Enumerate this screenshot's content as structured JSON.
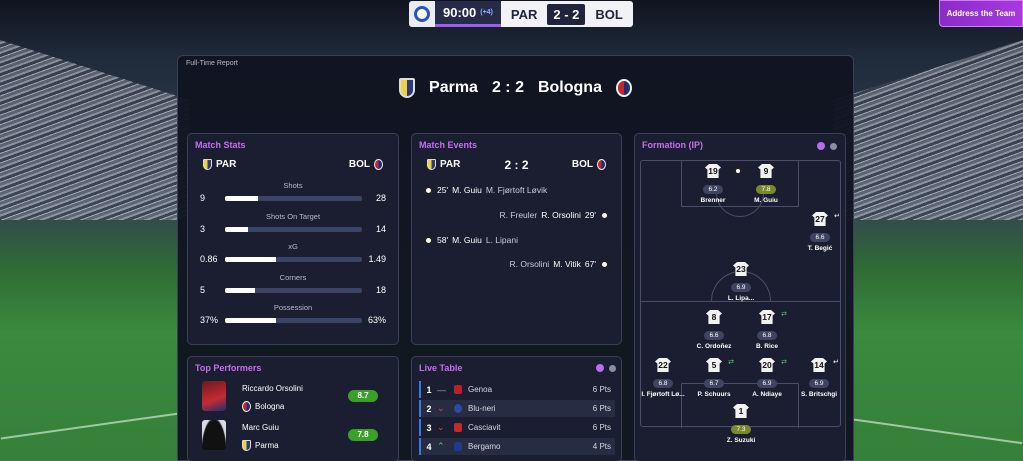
{
  "scoreboard": {
    "clock": "90:00",
    "added_time": "(+4)",
    "home": "PAR",
    "away": "BOL",
    "score": "2 - 2"
  },
  "address_button": "Address the Team",
  "report": {
    "label": "Full-Time Report",
    "home": "Parma",
    "away": "Bologna",
    "score": "2 : 2"
  },
  "match_stats": {
    "title": "Match Stats",
    "home": "PAR",
    "away": "BOL",
    "rows": [
      {
        "label": "Shots",
        "home": "9",
        "away": "28",
        "share": 0.24
      },
      {
        "label": "Shots On Target",
        "home": "3",
        "away": "14",
        "share": 0.17
      },
      {
        "label": "xG",
        "home": "0.86",
        "away": "1.49",
        "share": 0.37
      },
      {
        "label": "Corners",
        "home": "5",
        "away": "18",
        "share": 0.22
      },
      {
        "label": "Possession",
        "home": "37%",
        "away": "63%",
        "share": 0.37
      }
    ]
  },
  "match_events": {
    "title": "Match Events",
    "home": "PAR",
    "away": "BOL",
    "score": "2 : 2",
    "events": [
      {
        "side": "home",
        "minute": "25'",
        "scorer": "M. Guiu",
        "assist": "M. Fjørtoft Løvik"
      },
      {
        "side": "away",
        "minute": "29'",
        "scorer": "R. Orsolini",
        "assist": "R. Freuler"
      },
      {
        "side": "home",
        "minute": "58'",
        "scorer": "M. Guiu",
        "assist": "L. Lipani"
      },
      {
        "side": "away",
        "minute": "67'",
        "scorer": "M. Vitik",
        "assist": "R. Orsolini"
      }
    ]
  },
  "top_performers": {
    "title": "Top Performers",
    "players": [
      {
        "name": "Riccardo Orsolini",
        "club": "Bologna",
        "rating": "8.7"
      },
      {
        "name": "Marc Guiu",
        "club": "Parma",
        "rating": "7.8"
      }
    ]
  },
  "live_table": {
    "title": "Live Table",
    "rows": [
      {
        "pos": "1",
        "trend": "—",
        "team": "Genoa",
        "pts": "6 Pts",
        "color": "#b8202a"
      },
      {
        "pos": "2",
        "trend": "⌄",
        "team": "Blu-neri",
        "pts": "6 Pts",
        "color": "#2a4aa8"
      },
      {
        "pos": "3",
        "trend": "⌄",
        "team": "Casciavit",
        "pts": "6 Pts",
        "color": "#c02a2a"
      },
      {
        "pos": "4",
        "trend": "⌃",
        "team": "Bergamo",
        "pts": "4 Pts",
        "color": "#1e3a8a"
      }
    ]
  },
  "formation": {
    "title": "Formation (IP)",
    "players": [
      {
        "num": "19",
        "rating": "6.2",
        "name": "Brenner"
      },
      {
        "num": "9",
        "rating": "7.8",
        "name": "M. Guiu"
      },
      {
        "num": "27",
        "rating": "6.6",
        "name": "T. Begić"
      },
      {
        "num": "23",
        "rating": "6.9",
        "name": "L. Lipa..."
      },
      {
        "num": "8",
        "rating": "6.6",
        "name": "C. Ordoñez"
      },
      {
        "num": "17",
        "rating": "6.8",
        "name": "B. Rice"
      },
      {
        "num": "22",
        "rating": "6.8",
        "name": "I. Fjørtoft Lø..."
      },
      {
        "num": "5",
        "rating": "6.7",
        "name": "P. Schuurs"
      },
      {
        "num": "20",
        "rating": "6.9",
        "name": "A. Ndiaye"
      },
      {
        "num": "14",
        "rating": "6.9",
        "name": "S. Britschgi"
      },
      {
        "num": "1",
        "rating": "7.3",
        "name": "Z. Suzuki"
      }
    ]
  },
  "colors": {
    "accent": "#c46ff0",
    "rating_green": "#3aa02a",
    "panel": "#1b1e31"
  }
}
